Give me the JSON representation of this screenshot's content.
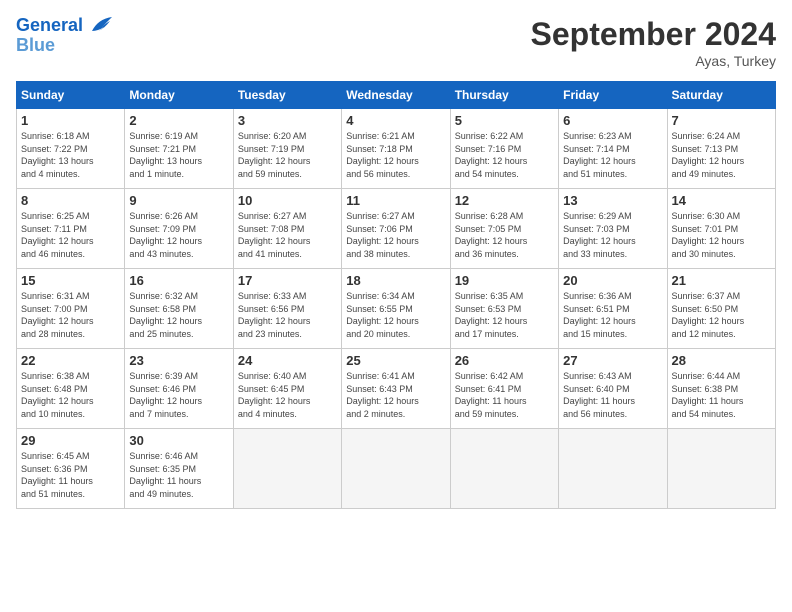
{
  "header": {
    "logo_line1": "General",
    "logo_line2": "Blue",
    "title": "September 2024",
    "subtitle": "Ayas, Turkey"
  },
  "days_of_week": [
    "Sunday",
    "Monday",
    "Tuesday",
    "Wednesday",
    "Thursday",
    "Friday",
    "Saturday"
  ],
  "weeks": [
    [
      {
        "day": "1",
        "info": "Sunrise: 6:18 AM\nSunset: 7:22 PM\nDaylight: 13 hours\nand 4 minutes."
      },
      {
        "day": "2",
        "info": "Sunrise: 6:19 AM\nSunset: 7:21 PM\nDaylight: 13 hours\nand 1 minute."
      },
      {
        "day": "3",
        "info": "Sunrise: 6:20 AM\nSunset: 7:19 PM\nDaylight: 12 hours\nand 59 minutes."
      },
      {
        "day": "4",
        "info": "Sunrise: 6:21 AM\nSunset: 7:18 PM\nDaylight: 12 hours\nand 56 minutes."
      },
      {
        "day": "5",
        "info": "Sunrise: 6:22 AM\nSunset: 7:16 PM\nDaylight: 12 hours\nand 54 minutes."
      },
      {
        "day": "6",
        "info": "Sunrise: 6:23 AM\nSunset: 7:14 PM\nDaylight: 12 hours\nand 51 minutes."
      },
      {
        "day": "7",
        "info": "Sunrise: 6:24 AM\nSunset: 7:13 PM\nDaylight: 12 hours\nand 49 minutes."
      }
    ],
    [
      {
        "day": "8",
        "info": "Sunrise: 6:25 AM\nSunset: 7:11 PM\nDaylight: 12 hours\nand 46 minutes."
      },
      {
        "day": "9",
        "info": "Sunrise: 6:26 AM\nSunset: 7:09 PM\nDaylight: 12 hours\nand 43 minutes."
      },
      {
        "day": "10",
        "info": "Sunrise: 6:27 AM\nSunset: 7:08 PM\nDaylight: 12 hours\nand 41 minutes."
      },
      {
        "day": "11",
        "info": "Sunrise: 6:27 AM\nSunset: 7:06 PM\nDaylight: 12 hours\nand 38 minutes."
      },
      {
        "day": "12",
        "info": "Sunrise: 6:28 AM\nSunset: 7:05 PM\nDaylight: 12 hours\nand 36 minutes."
      },
      {
        "day": "13",
        "info": "Sunrise: 6:29 AM\nSunset: 7:03 PM\nDaylight: 12 hours\nand 33 minutes."
      },
      {
        "day": "14",
        "info": "Sunrise: 6:30 AM\nSunset: 7:01 PM\nDaylight: 12 hours\nand 30 minutes."
      }
    ],
    [
      {
        "day": "15",
        "info": "Sunrise: 6:31 AM\nSunset: 7:00 PM\nDaylight: 12 hours\nand 28 minutes."
      },
      {
        "day": "16",
        "info": "Sunrise: 6:32 AM\nSunset: 6:58 PM\nDaylight: 12 hours\nand 25 minutes."
      },
      {
        "day": "17",
        "info": "Sunrise: 6:33 AM\nSunset: 6:56 PM\nDaylight: 12 hours\nand 23 minutes."
      },
      {
        "day": "18",
        "info": "Sunrise: 6:34 AM\nSunset: 6:55 PM\nDaylight: 12 hours\nand 20 minutes."
      },
      {
        "day": "19",
        "info": "Sunrise: 6:35 AM\nSunset: 6:53 PM\nDaylight: 12 hours\nand 17 minutes."
      },
      {
        "day": "20",
        "info": "Sunrise: 6:36 AM\nSunset: 6:51 PM\nDaylight: 12 hours\nand 15 minutes."
      },
      {
        "day": "21",
        "info": "Sunrise: 6:37 AM\nSunset: 6:50 PM\nDaylight: 12 hours\nand 12 minutes."
      }
    ],
    [
      {
        "day": "22",
        "info": "Sunrise: 6:38 AM\nSunset: 6:48 PM\nDaylight: 12 hours\nand 10 minutes."
      },
      {
        "day": "23",
        "info": "Sunrise: 6:39 AM\nSunset: 6:46 PM\nDaylight: 12 hours\nand 7 minutes."
      },
      {
        "day": "24",
        "info": "Sunrise: 6:40 AM\nSunset: 6:45 PM\nDaylight: 12 hours\nand 4 minutes."
      },
      {
        "day": "25",
        "info": "Sunrise: 6:41 AM\nSunset: 6:43 PM\nDaylight: 12 hours\nand 2 minutes."
      },
      {
        "day": "26",
        "info": "Sunrise: 6:42 AM\nSunset: 6:41 PM\nDaylight: 11 hours\nand 59 minutes."
      },
      {
        "day": "27",
        "info": "Sunrise: 6:43 AM\nSunset: 6:40 PM\nDaylight: 11 hours\nand 56 minutes."
      },
      {
        "day": "28",
        "info": "Sunrise: 6:44 AM\nSunset: 6:38 PM\nDaylight: 11 hours\nand 54 minutes."
      }
    ],
    [
      {
        "day": "29",
        "info": "Sunrise: 6:45 AM\nSunset: 6:36 PM\nDaylight: 11 hours\nand 51 minutes."
      },
      {
        "day": "30",
        "info": "Sunrise: 6:46 AM\nSunset: 6:35 PM\nDaylight: 11 hours\nand 49 minutes."
      },
      {
        "day": "",
        "info": ""
      },
      {
        "day": "",
        "info": ""
      },
      {
        "day": "",
        "info": ""
      },
      {
        "day": "",
        "info": ""
      },
      {
        "day": "",
        "info": ""
      }
    ]
  ]
}
